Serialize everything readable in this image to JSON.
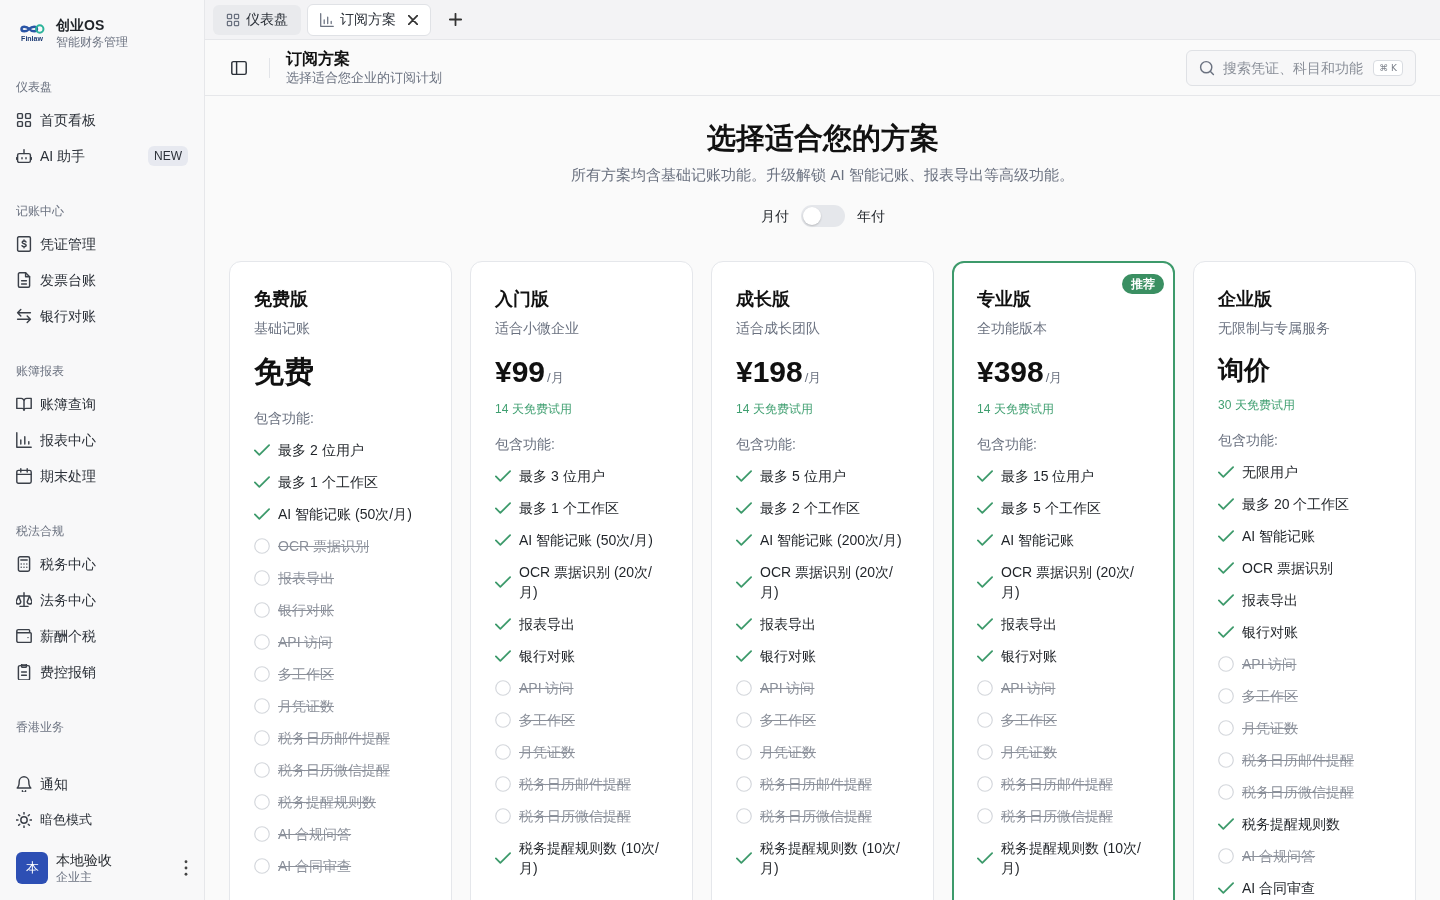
{
  "sidebar": {
    "logo_text": "Finlaw",
    "app_name": "创业OS",
    "tagline": "智能财务管理",
    "sections": [
      {
        "heading": "仪表盘",
        "items": [
          {
            "label": "首页看板",
            "selected": false
          },
          {
            "label": "AI 助手",
            "badge": "NEW",
            "selected": false
          }
        ]
      },
      {
        "heading": "记账中心",
        "items": [
          {
            "label": "凭证管理",
            "selected": false
          },
          {
            "label": "发票台账",
            "selected": false
          },
          {
            "label": "银行对账",
            "selected": false
          }
        ]
      },
      {
        "heading": "账簿报表",
        "items": [
          {
            "label": "账簿查询",
            "selected": false
          },
          {
            "label": "报表中心",
            "selected": false
          },
          {
            "label": "期末处理",
            "selected": false
          }
        ]
      },
      {
        "heading": "税法合规",
        "items": [
          {
            "label": "税务中心",
            "selected": false
          },
          {
            "label": "法务中心",
            "selected": false
          },
          {
            "label": "薪酬个税",
            "selected": false
          },
          {
            "label": "费控报销",
            "selected": false
          }
        ]
      },
      {
        "heading": "香港业务"
      }
    ],
    "footer_items": [
      {
        "label": "通知"
      },
      {
        "label": "暗色模式"
      }
    ],
    "user": {
      "avatar_text": "本",
      "name": "本地验收",
      "role": "企业主"
    }
  },
  "tabs": [
    {
      "label": "仪表盘",
      "selected": false
    },
    {
      "label": "订阅方案",
      "selected": true
    }
  ],
  "header": {
    "title": "订阅方案",
    "subtitle": "选择适合您企业的订阅计划",
    "search": {
      "placeholder": "搜索凭证、科目和功能",
      "shortcut": "⌘ K"
    }
  },
  "pricing": {
    "title": "选择适合您的方案",
    "subtitle": "所有方案均含基础记账功能。升级解锁 AI 智能记账、报表导出等高级功能。",
    "billing_toggle": {
      "left_label": "月付",
      "right_label": "年付",
      "on": false
    },
    "plans": [
      {
        "kind": "free",
        "name": "免费版",
        "subtitle": "基础记账",
        "price": "免费",
        "highlighted": false,
        "features_heading": "包含功能:",
        "features": [
          {
            "label": "最多 2 位用户",
            "included": true
          },
          {
            "label": "最多 1 个工作区",
            "included": true
          },
          {
            "label": "AI 智能记账 (50次/月)",
            "included": true
          },
          {
            "label": "OCR 票据识别",
            "included": false
          },
          {
            "label": "报表导出",
            "included": false
          },
          {
            "label": "银行对账",
            "included": false
          },
          {
            "label": "API 访问",
            "included": false
          },
          {
            "label": "多工作区",
            "included": false
          },
          {
            "label": "月凭证数",
            "included": false
          },
          {
            "label": "税务日历邮件提醒",
            "included": false
          },
          {
            "label": "税务日历微信提醒",
            "included": false
          },
          {
            "label": "税务提醒规则数",
            "included": false
          },
          {
            "label": "AI 合规问答",
            "included": false
          },
          {
            "label": "AI 合同审查",
            "included": false
          }
        ]
      },
      {
        "kind": "paid",
        "name": "入门版",
        "subtitle": "适合小微企业",
        "price": "¥99",
        "period": "/月",
        "trial": "14 天免费试用",
        "highlighted": false,
        "features_heading": "包含功能:",
        "features": [
          {
            "label": "最多 3 位用户",
            "included": true
          },
          {
            "label": "最多 1 个工作区",
            "included": true
          },
          {
            "label": "AI 智能记账 (50次/月)",
            "included": true
          },
          {
            "label": "OCR 票据识别 (20次/月)",
            "included": true
          },
          {
            "label": "报表导出",
            "included": true
          },
          {
            "label": "银行对账",
            "included": true
          },
          {
            "label": "API 访问",
            "included": false
          },
          {
            "label": "多工作区",
            "included": false
          },
          {
            "label": "月凭证数",
            "included": false
          },
          {
            "label": "税务日历邮件提醒",
            "included": false
          },
          {
            "label": "税务日历微信提醒",
            "included": false
          },
          {
            "label": "税务提醒规则数 (10次/月)",
            "included": true
          }
        ]
      },
      {
        "kind": "paid",
        "name": "成长版",
        "subtitle": "适合成长团队",
        "price": "¥198",
        "period": "/月",
        "trial": "14 天免费试用",
        "highlighted": false,
        "features_heading": "包含功能:",
        "features": [
          {
            "label": "最多 5 位用户",
            "included": true
          },
          {
            "label": "最多 2 个工作区",
            "included": true
          },
          {
            "label": "AI 智能记账 (200次/月)",
            "included": true
          },
          {
            "label": "OCR 票据识别 (20次/月)",
            "included": true
          },
          {
            "label": "报表导出",
            "included": true
          },
          {
            "label": "银行对账",
            "included": true
          },
          {
            "label": "API 访问",
            "included": false
          },
          {
            "label": "多工作区",
            "included": false
          },
          {
            "label": "月凭证数",
            "included": false
          },
          {
            "label": "税务日历邮件提醒",
            "included": false
          },
          {
            "label": "税务日历微信提醒",
            "included": false
          },
          {
            "label": "税务提醒规则数 (10次/月)",
            "included": true
          }
        ]
      },
      {
        "kind": "paid",
        "name": "专业版",
        "subtitle": "全功能版本",
        "price": "¥398",
        "period": "/月",
        "trial": "14 天免费试用",
        "badge": "推荐",
        "highlighted": true,
        "features_heading": "包含功能:",
        "features": [
          {
            "label": "最多 15 位用户",
            "included": true
          },
          {
            "label": "最多 5 个工作区",
            "included": true
          },
          {
            "label": "AI 智能记账",
            "included": true
          },
          {
            "label": "OCR 票据识别 (20次/月)",
            "included": true
          },
          {
            "label": "报表导出",
            "included": true
          },
          {
            "label": "银行对账",
            "included": true
          },
          {
            "label": "API 访问",
            "included": false
          },
          {
            "label": "多工作区",
            "included": false
          },
          {
            "label": "月凭证数",
            "included": false
          },
          {
            "label": "税务日历邮件提醒",
            "included": false
          },
          {
            "label": "税务日历微信提醒",
            "included": false
          },
          {
            "label": "税务提醒规则数 (10次/月)",
            "included": true
          }
        ]
      },
      {
        "kind": "quote",
        "name": "企业版",
        "subtitle": "无限制与专属服务",
        "price": "询价",
        "trial": "30 天免费试用",
        "highlighted": false,
        "features_heading": "包含功能:",
        "features": [
          {
            "label": "无限用户",
            "included": true
          },
          {
            "label": "最多 20 个工作区",
            "included": true
          },
          {
            "label": "AI 智能记账",
            "included": true
          },
          {
            "label": "OCR 票据识别",
            "included": true
          },
          {
            "label": "报表导出",
            "included": true
          },
          {
            "label": "银行对账",
            "included": true
          },
          {
            "label": "API 访问",
            "included": false
          },
          {
            "label": "多工作区",
            "included": false
          },
          {
            "label": "月凭证数",
            "included": false
          },
          {
            "label": "税务日历邮件提醒",
            "included": false
          },
          {
            "label": "税务日历微信提醒",
            "included": false
          },
          {
            "label": "税务提醒规则数",
            "included": true
          },
          {
            "label": "AI 合规问答",
            "included": false
          },
          {
            "label": "AI 合同审查",
            "included": true
          }
        ]
      }
    ]
  }
}
